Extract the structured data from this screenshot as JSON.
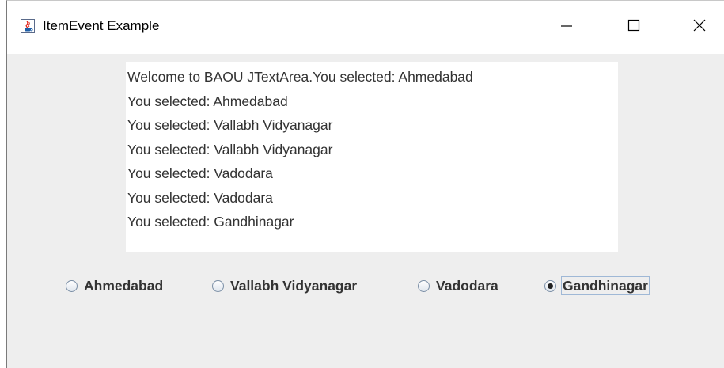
{
  "window": {
    "title": "ItemEvent Example",
    "icon": "java-cup-icon",
    "controls": {
      "minimize": "minimize-icon",
      "maximize": "maximize-icon",
      "close": "close-icon"
    }
  },
  "textarea": {
    "lines": [
      "Welcome to BAOU JTextArea.You selected: Ahmedabad",
      "You selected: Ahmedabad",
      "You selected: Vallabh Vidyanagar",
      "You selected: Vallabh Vidyanagar",
      "You selected: Vadodara",
      "You selected: Vadodara",
      "You selected: Gandhinagar"
    ]
  },
  "radios": [
    {
      "label": "Ahmedabad",
      "selected": false
    },
    {
      "label": "Vallabh Vidyanagar",
      "selected": false
    },
    {
      "label": "Vadodara",
      "selected": false
    },
    {
      "label": "Gandhinagar",
      "selected": true
    }
  ]
}
